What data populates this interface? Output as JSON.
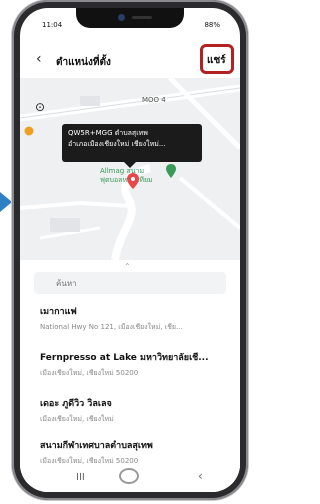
{
  "status_bar": {
    "time": "11:04",
    "right": "88%"
  },
  "header": {
    "back_icon": "‹",
    "title": "ตำแหน่งที่ตั้ง",
    "share_label": "แชร์"
  },
  "map": {
    "road_moo": "MOO 4",
    "callout_line1": "QW5R+MGG ตำบลสุเทพ",
    "callout_line2": "อำเภอเมืองเชียงใหม่ เชียงใหม่...",
    "poi_line1": "Allmag สนาม",
    "poi_line2": "ฟุตบอลหญ้าเทียม"
  },
  "search": {
    "placeholder": "ค้นหา"
  },
  "places": [
    {
      "name": "เมากาแฟ",
      "address": "National Hwy No 121, เมืองเชียงใหม่, เชีย..."
    },
    {
      "name": "Fernpresso at Lake มหาวิทยาลัยเชี...",
      "address": "เมืองเชียงใหม่, เชียงใหม่ 50200"
    },
    {
      "name": "เดอะ ภูดีวิว วิลเลจ",
      "address": "เมืองเชียงใหม่, เชียงใหม่"
    },
    {
      "name": "สนามกีฬาเทศบาลตำบลสุเทพ",
      "address": "เมืองเชียงใหม่, เชียงใหม่ 50200"
    }
  ],
  "navbar": {
    "recent": "III",
    "back": "‹"
  }
}
